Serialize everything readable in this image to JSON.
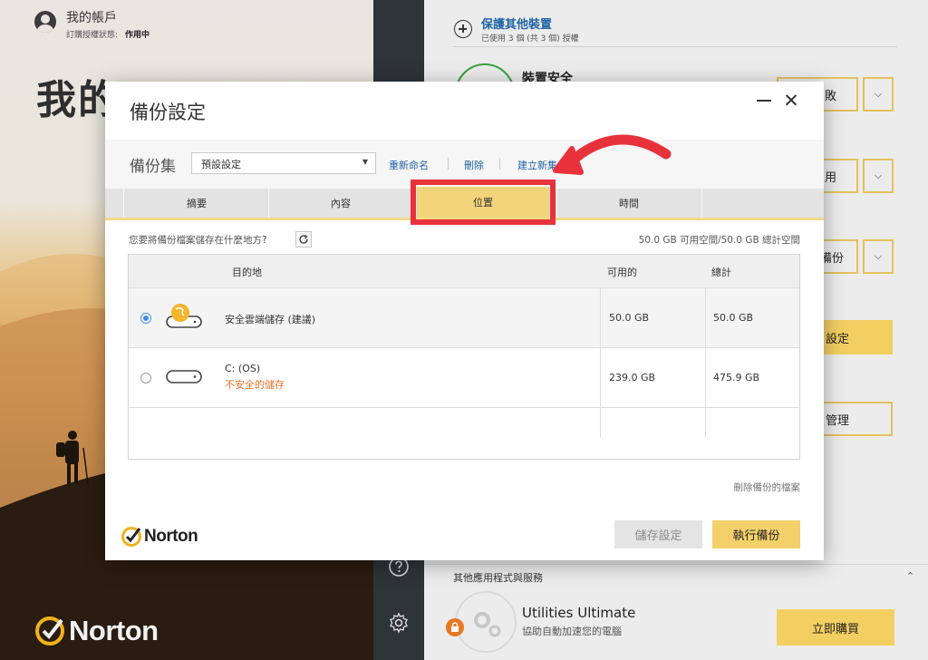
{
  "account": {
    "title": "我的帳戶",
    "status_label": "訂購授權狀態:",
    "status_value": "作用中"
  },
  "left_heading": "我的 N",
  "logo_text": "Norton",
  "right_panel": {
    "protect_title": "保護其他裝置",
    "protect_sub": "已使用 3 個 (共 3 個) 授權",
    "device_title": "裝置安全",
    "buttons": [
      "敗",
      "用",
      "備份",
      "設定",
      "管理"
    ],
    "other_title": "其他應用程式與服務",
    "utilities_title": "Utilities Ultimate",
    "utilities_sub": "協助自動加速您的電腦",
    "buy_label": "立即購買"
  },
  "modal": {
    "title": "備份設定",
    "set_label": "備份集",
    "set_value": "預設設定",
    "rename": "重新命名",
    "delete": "刪除",
    "create": "建立新集",
    "tabs": [
      "摘要",
      "內容",
      "位置",
      "時間"
    ],
    "question": "您要將備份檔案儲存在什麼地方?",
    "space": "50.0 GB 可用空間/50.0 GB 總計空間",
    "columns": {
      "destination": "目的地",
      "available": "可用的",
      "total": "總計"
    },
    "rows": [
      {
        "name": "安全雲端儲存 (建議)",
        "available": "50.0 GB",
        "total": "50.0 GB",
        "selected": true
      },
      {
        "name": "C: (OS)",
        "note": "不安全的儲存",
        "available": "239.0 GB",
        "total": "475.9 GB",
        "selected": false
      }
    ],
    "delete_files": "刪除備份的檔案",
    "save_label": "儲存設定",
    "run_label": "執行備份"
  },
  "colors": {
    "accent_yellow": "#f3cf62",
    "annotation_red": "#e8323b",
    "link_blue": "#1f63a6",
    "warning_orange": "#e8762a",
    "sidebar_dark": "#2d3438"
  },
  "icons": [
    "user-icon",
    "plus-circle-icon",
    "help-icon",
    "gear-icon",
    "chevron-down-icon",
    "refresh-icon",
    "cloud-drive-icon",
    "hard-drive-icon",
    "lock-icon",
    "norton-check-icon",
    "close-icon",
    "minimize-icon"
  ]
}
